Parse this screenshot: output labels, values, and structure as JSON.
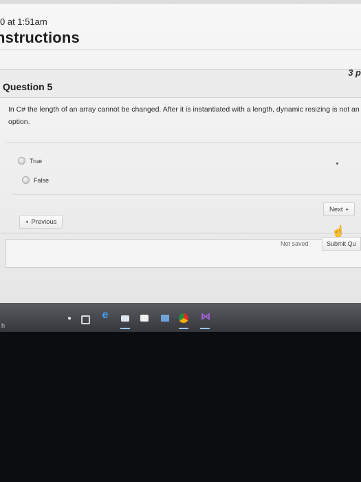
{
  "header": {
    "timestamp": "0 at 1:51am",
    "title": "nstructions"
  },
  "question": {
    "label": "Question 5",
    "points": "3 p",
    "text": "In C# the length of an array cannot be changed. After it is instantiated with a length, dynamic resizing is not an option.",
    "options": [
      {
        "label": "True",
        "selected": false
      },
      {
        "label": "False",
        "selected": false
      }
    ]
  },
  "navigation": {
    "previous_label": "Previous",
    "next_label": "Next"
  },
  "footer": {
    "status": "Not saved",
    "submit_label": "Submit Qu"
  },
  "taskbar": {
    "left_text": "h",
    "icons": [
      "microphone-icon",
      "task-view-icon",
      "edge-icon",
      "mail-icon",
      "store-icon",
      "photos-icon",
      "chrome-icon",
      "visual-studio-icon"
    ]
  },
  "colors": {
    "page_bg": "#f1f1f1",
    "taskbar_bg": "#45474c",
    "text": "#2a2a2a"
  }
}
